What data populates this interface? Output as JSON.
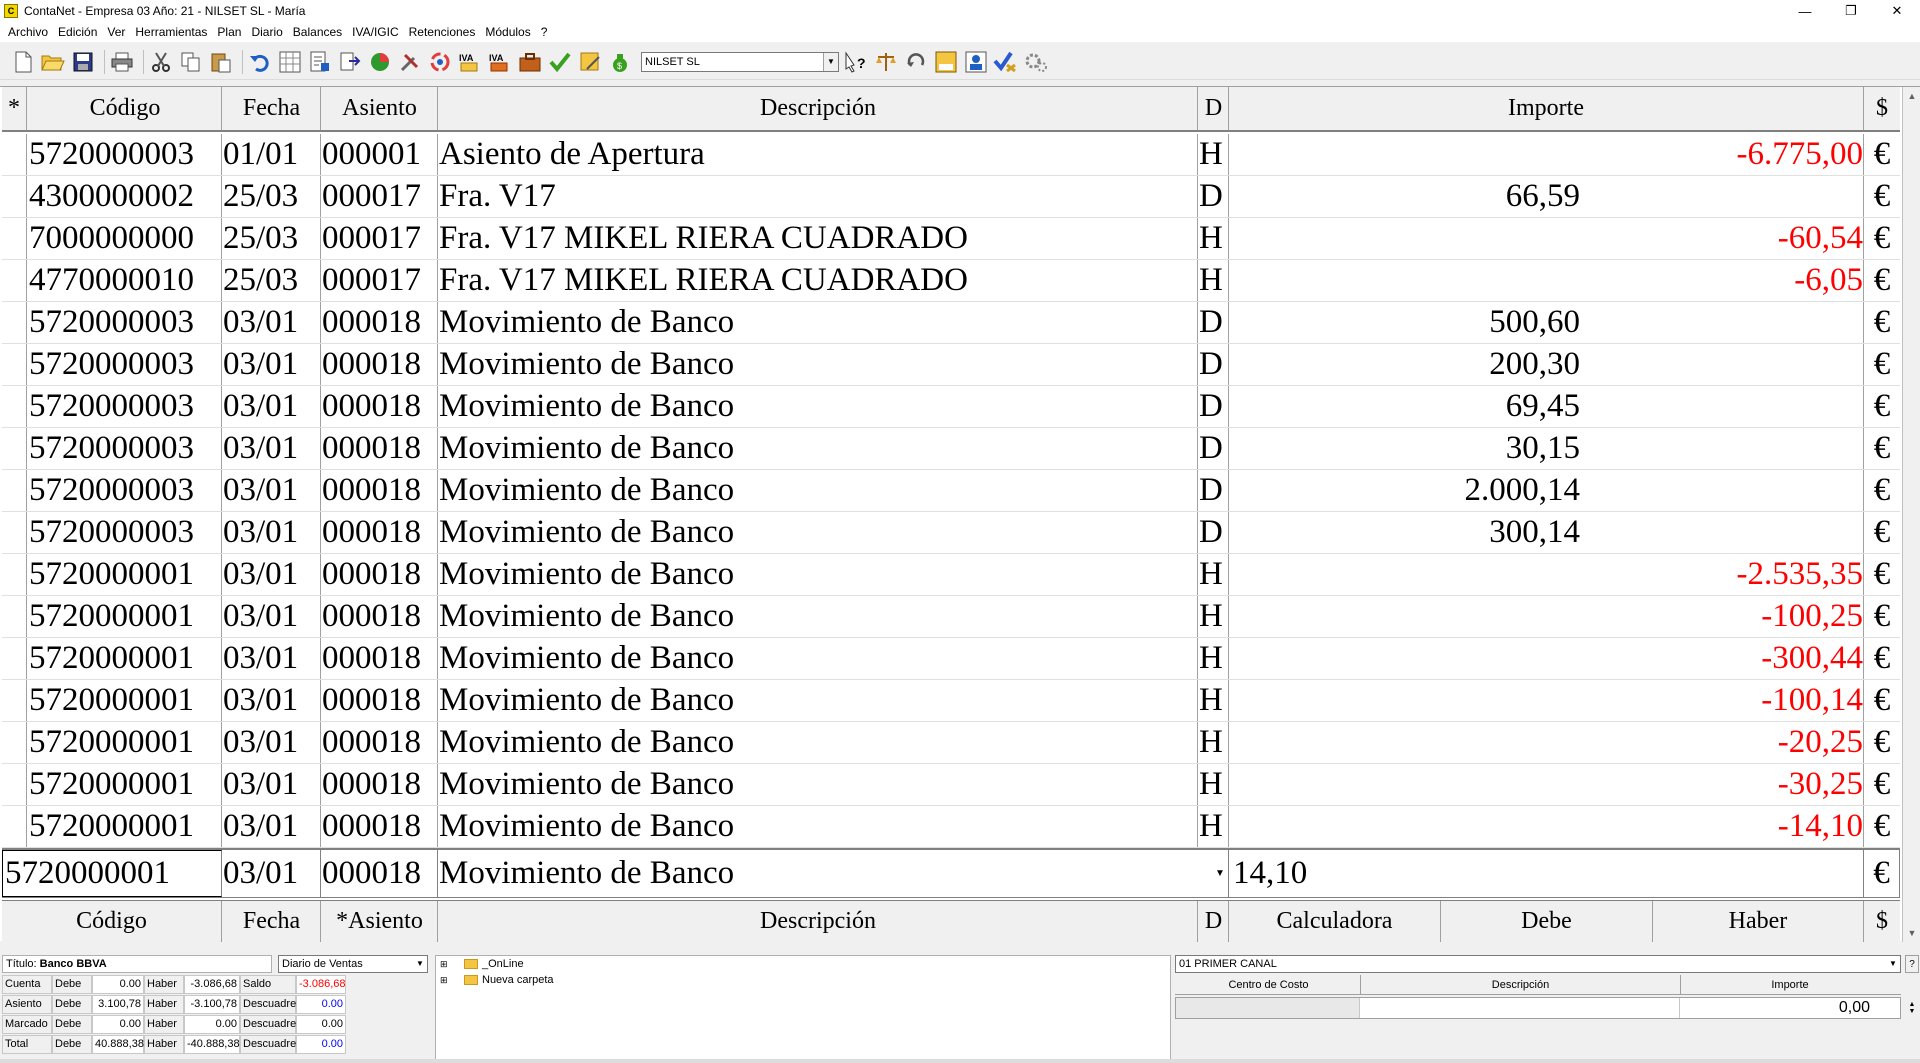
{
  "window": {
    "title": "ContaNet - Empresa 03  Año: 21 - NILSET SL - María",
    "app_icon_text": "C"
  },
  "menu": [
    "Archivo",
    "Edición",
    "Ver",
    "Herramientas",
    "Plan",
    "Diario",
    "Balances",
    "IVA/IGIC",
    "Retenciones",
    "Módulos",
    "?"
  ],
  "toolbar": {
    "company": "NILSET SL",
    "iva_label": "IVA"
  },
  "grid": {
    "headers": {
      "star": "*",
      "codigo": "Código",
      "fecha": "Fecha",
      "asiento": "Asiento",
      "descripcion": "Descripción",
      "d": "D",
      "importe": "Importe",
      "currency": "$"
    },
    "rows": [
      {
        "codigo": "5720000003",
        "fecha": "01/01",
        "asiento": "000001",
        "descripcion": "Asiento de Apertura",
        "d": "H",
        "debe": "",
        "haber": "-6.775,00",
        "cur": "€"
      },
      {
        "codigo": "4300000002",
        "fecha": "25/03",
        "asiento": "000017",
        "descripcion": "Fra.  V17",
        "d": "D",
        "debe": "66,59",
        "haber": "",
        "cur": "€"
      },
      {
        "codigo": "7000000000",
        "fecha": "25/03",
        "asiento": "000017",
        "descripcion": "Fra.  V17 MIKEL RIERA CUADRADO",
        "d": "H",
        "debe": "",
        "haber": "-60,54",
        "cur": "€"
      },
      {
        "codigo": "4770000010",
        "fecha": "25/03",
        "asiento": "000017",
        "descripcion": "Fra.  V17 MIKEL RIERA CUADRADO",
        "d": "H",
        "debe": "",
        "haber": "-6,05",
        "cur": "€"
      },
      {
        "codigo": "5720000003",
        "fecha": "03/01",
        "asiento": "000018",
        "descripcion": "Movimiento de Banco",
        "d": "D",
        "debe": "500,60",
        "haber": "",
        "cur": "€"
      },
      {
        "codigo": "5720000003",
        "fecha": "03/01",
        "asiento": "000018",
        "descripcion": "Movimiento de Banco",
        "d": "D",
        "debe": "200,30",
        "haber": "",
        "cur": "€"
      },
      {
        "codigo": "5720000003",
        "fecha": "03/01",
        "asiento": "000018",
        "descripcion": "Movimiento de Banco",
        "d": "D",
        "debe": "69,45",
        "haber": "",
        "cur": "€"
      },
      {
        "codigo": "5720000003",
        "fecha": "03/01",
        "asiento": "000018",
        "descripcion": "Movimiento de Banco",
        "d": "D",
        "debe": "30,15",
        "haber": "",
        "cur": "€"
      },
      {
        "codigo": "5720000003",
        "fecha": "03/01",
        "asiento": "000018",
        "descripcion": "Movimiento de Banco",
        "d": "D",
        "debe": "2.000,14",
        "haber": "",
        "cur": "€"
      },
      {
        "codigo": "5720000003",
        "fecha": "03/01",
        "asiento": "000018",
        "descripcion": "Movimiento de Banco",
        "d": "D",
        "debe": "300,14",
        "haber": "",
        "cur": "€"
      },
      {
        "codigo": "5720000001",
        "fecha": "03/01",
        "asiento": "000018",
        "descripcion": "Movimiento de Banco",
        "d": "H",
        "debe": "",
        "haber": "-2.535,35",
        "cur": "€"
      },
      {
        "codigo": "5720000001",
        "fecha": "03/01",
        "asiento": "000018",
        "descripcion": "Movimiento de Banco",
        "d": "H",
        "debe": "",
        "haber": "-100,25",
        "cur": "€"
      },
      {
        "codigo": "5720000001",
        "fecha": "03/01",
        "asiento": "000018",
        "descripcion": "Movimiento de Banco",
        "d": "H",
        "debe": "",
        "haber": "-300,44",
        "cur": "€"
      },
      {
        "codigo": "5720000001",
        "fecha": "03/01",
        "asiento": "000018",
        "descripcion": "Movimiento de Banco",
        "d": "H",
        "debe": "",
        "haber": "-100,14",
        "cur": "€"
      },
      {
        "codigo": "5720000001",
        "fecha": "03/01",
        "asiento": "000018",
        "descripcion": "Movimiento de Banco",
        "d": "H",
        "debe": "",
        "haber": "-20,25",
        "cur": "€"
      },
      {
        "codigo": "5720000001",
        "fecha": "03/01",
        "asiento": "000018",
        "descripcion": "Movimiento de Banco",
        "d": "H",
        "debe": "",
        "haber": "-30,25",
        "cur": "€"
      },
      {
        "codigo": "5720000001",
        "fecha": "03/01",
        "asiento": "000018",
        "descripcion": "Movimiento de Banco",
        "d": "H",
        "debe": "",
        "haber": "-14,10",
        "cur": "€"
      }
    ],
    "entry": {
      "codigo": "5720000001",
      "fecha": "03/01",
      "asiento": "000018",
      "descripcion": "Movimiento de Banco",
      "importe": "14,10",
      "cur": "€"
    },
    "footer": {
      "codigo": "Código",
      "fecha": "Fecha",
      "asiento": "*Asiento",
      "descripcion": "Descripción",
      "d": "D",
      "calculadora": "Calculadora",
      "debe": "Debe",
      "haber": "Haber",
      "currency": "$"
    }
  },
  "summary": {
    "titulo_label": "Título:",
    "titulo_value": "Banco BBVA",
    "diario": "Diario de Ventas",
    "rows": [
      {
        "label": "Cuenta",
        "debe_k": "Debe",
        "debe": "0.00",
        "haber_k": "Haber",
        "haber": "-3.086,68",
        "k3": "Saldo",
        "v3": "-3.086,68",
        "v3_color": "#ff0000"
      },
      {
        "label": "Asiento",
        "debe_k": "Debe",
        "debe": "3.100,78",
        "haber_k": "Haber",
        "haber": "-3.100,78",
        "k3": "Descuadre",
        "v3": "0.00",
        "v3_color": "#0000ff"
      },
      {
        "label": "Marcado",
        "debe_k": "Debe",
        "debe": "0.00",
        "haber_k": "Haber",
        "haber": "0.00",
        "k3": "Descuadre",
        "v3": "0.00",
        "v3_color": "#000000"
      },
      {
        "label": "Total",
        "debe_k": "Debe",
        "debe": "40.888,38",
        "haber_k": "Haber",
        "haber": "-40.888,38",
        "k3": "Descuadre",
        "v3": "0.00",
        "v3_color": "#0000ff"
      }
    ]
  },
  "tree": {
    "items": [
      "_OnLine",
      "Nueva carpeta"
    ]
  },
  "cost_center": {
    "canal": "01 PRIMER CANAL",
    "help": "?",
    "headers": {
      "centro": "Centro de Costo",
      "descripcion": "Descripción",
      "importe": "Importe"
    },
    "importe_value": "0,00"
  }
}
